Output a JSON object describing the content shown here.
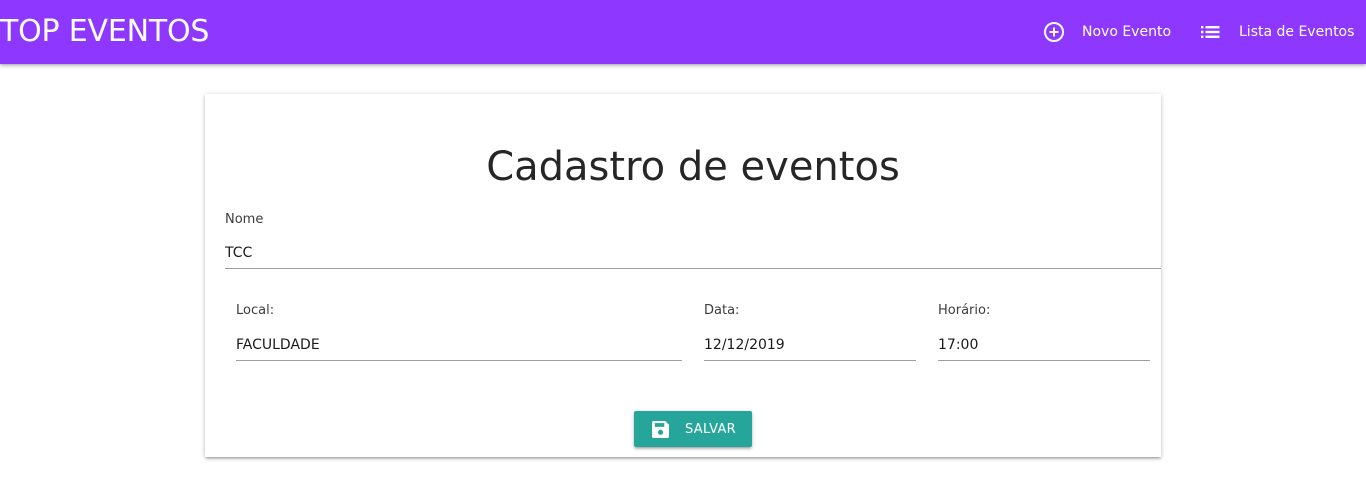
{
  "header": {
    "brand": "TOP EVENTOS",
    "nav": {
      "new_event_label": "Novo Evento",
      "event_list_label": "Lista de Eventos"
    },
    "icons": {
      "new_event": "add-circle-outline-icon",
      "event_list": "list-icon"
    },
    "background_color": "#8e38ff"
  },
  "form": {
    "title": "Cadastro de eventos",
    "fields": {
      "nome": {
        "label": "Nome",
        "value": "TCC"
      },
      "local": {
        "label": "Local:",
        "value": "FACULDADE"
      },
      "data": {
        "label": "Data:",
        "value": "12/12/2019"
      },
      "horario": {
        "label": "Horário:",
        "value": "17:00"
      }
    },
    "save_button": {
      "label": "SALVAR",
      "icon": "save-icon",
      "color": "#26a69a"
    }
  }
}
